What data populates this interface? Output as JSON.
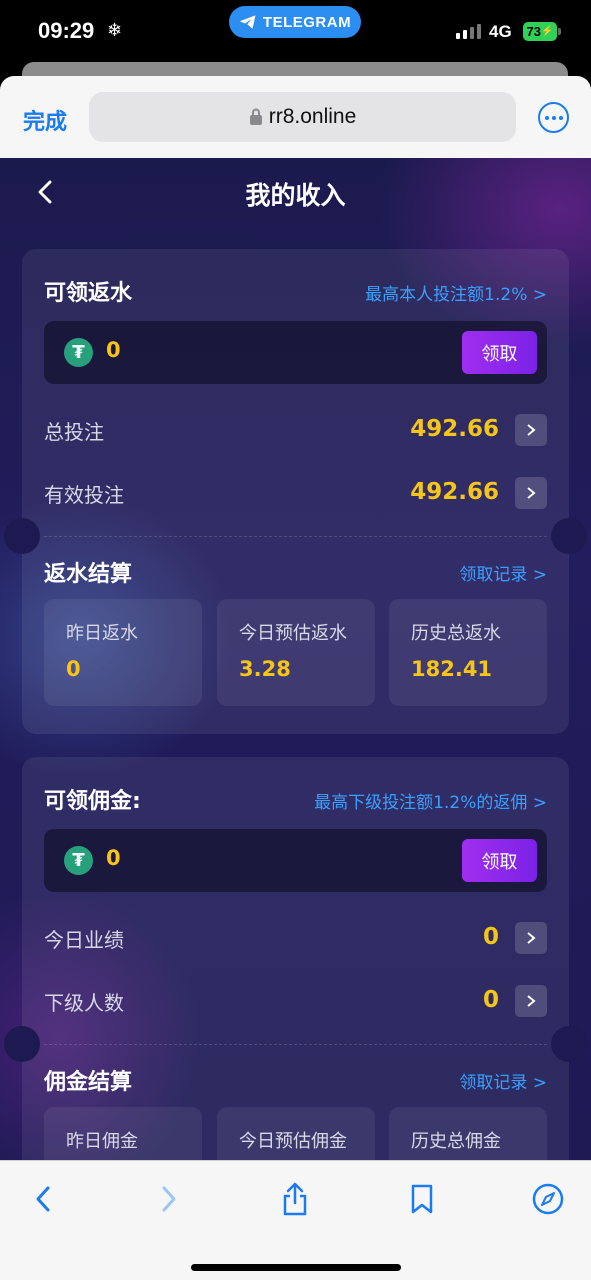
{
  "status_bar": {
    "time": "09:29",
    "snow": "❄",
    "pill_label": "TELEGRAM",
    "network": "4G",
    "battery": "73"
  },
  "browser": {
    "done_label": "完成",
    "url": "rr8.online"
  },
  "page": {
    "title": "我的收入"
  },
  "rebate": {
    "title": "可领返水",
    "link": "最高本人投注额1.2% >",
    "claim_amount": "0",
    "claim_button": "领取",
    "rows": [
      {
        "label": "总投注",
        "value": "492.66"
      },
      {
        "label": "有效投注",
        "value": "492.66"
      }
    ],
    "settle_title": "返水结算",
    "settle_link": "领取记录 >",
    "stats": [
      {
        "label": "昨日返水",
        "value": "0"
      },
      {
        "label": "今日预估返水",
        "value": "3.28"
      },
      {
        "label": "历史总返水",
        "value": "182.41"
      }
    ]
  },
  "commission": {
    "title": "可领佣金:",
    "link": "最高下级投注额1.2%的返佣 >",
    "claim_amount": "0",
    "claim_button": "领取",
    "rows": [
      {
        "label": "今日业绩",
        "value": "0"
      },
      {
        "label": "下级人数",
        "value": "0"
      }
    ],
    "settle_title": "佣金结算",
    "settle_link": "领取记录 >",
    "stats": [
      {
        "label": "昨日佣金"
      },
      {
        "label": "今日预估佣金"
      },
      {
        "label": "历史总佣金"
      }
    ]
  },
  "colors": {
    "accent_blue": "#1a7cf0",
    "link_blue": "#3aa0ff",
    "value_yellow": "#f5c518",
    "button_purple": "#8f29ec",
    "tether_green": "#27a17c"
  },
  "icons": [
    "snowflake-icon",
    "telegram-icon",
    "lock-icon",
    "more-icon",
    "back-chevron-icon",
    "tether-icon",
    "chevron-right-icon",
    "browser-back-icon",
    "browser-forward-icon",
    "share-icon",
    "bookmarks-icon",
    "compass-icon"
  ]
}
